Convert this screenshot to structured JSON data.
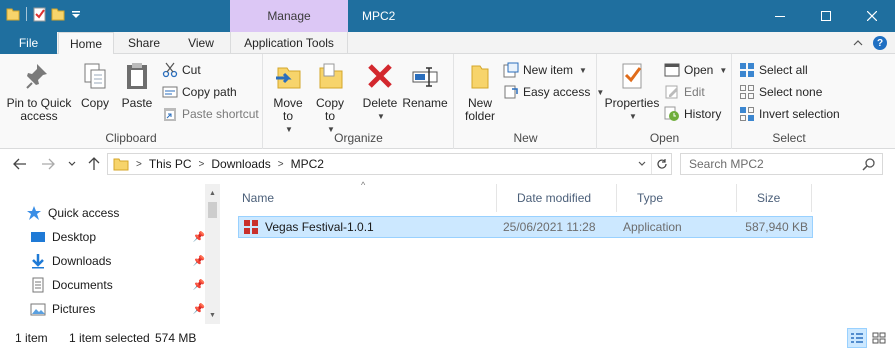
{
  "window": {
    "title": "MPC2",
    "context_tab_group": "Manage",
    "colors": {
      "titlebar": "#1f6f9f",
      "context": "#dcc7f5",
      "selection": "#cce8ff"
    }
  },
  "tabs": {
    "file": "File",
    "home": "Home",
    "share": "Share",
    "view": "View",
    "app_tools": "Application Tools"
  },
  "ribbon": {
    "clipboard": {
      "label": "Clipboard",
      "pin": "Pin to Quick access",
      "copy": "Copy",
      "paste": "Paste",
      "cut": "Cut",
      "copy_path": "Copy path",
      "paste_shortcut": "Paste shortcut"
    },
    "organize": {
      "label": "Organize",
      "move_to": "Move to",
      "copy_to": "Copy to",
      "delete": "Delete",
      "rename": "Rename"
    },
    "new": {
      "label": "New",
      "new_folder": "New folder",
      "new_item": "New item",
      "easy_access": "Easy access"
    },
    "open": {
      "label": "Open",
      "properties": "Properties",
      "open": "Open",
      "edit": "Edit",
      "history": "History"
    },
    "select": {
      "label": "Select",
      "select_all": "Select all",
      "select_none": "Select none",
      "invert": "Invert selection"
    }
  },
  "address": {
    "crumbs": [
      "This PC",
      "Downloads",
      "MPC2"
    ],
    "search_placeholder": "Search MPC2"
  },
  "nav": {
    "items": [
      {
        "label": "Quick access",
        "icon": "star-icon",
        "pinned": false
      },
      {
        "label": "Desktop",
        "icon": "desktop-icon",
        "pinned": true
      },
      {
        "label": "Downloads",
        "icon": "downloads-icon",
        "pinned": true
      },
      {
        "label": "Documents",
        "icon": "documents-icon",
        "pinned": true
      },
      {
        "label": "Pictures",
        "icon": "pictures-icon",
        "pinned": true
      }
    ]
  },
  "columns": {
    "name": "Name",
    "date": "Date modified",
    "type": "Type",
    "size": "Size"
  },
  "files": [
    {
      "name": "Vegas Festival-1.0.1",
      "date": "25/06/2021 11:28",
      "type": "Application",
      "size": "587,940 KB",
      "selected": true
    }
  ],
  "status": {
    "count": "1 item",
    "selected": "1 item selected",
    "size": "574 MB"
  }
}
